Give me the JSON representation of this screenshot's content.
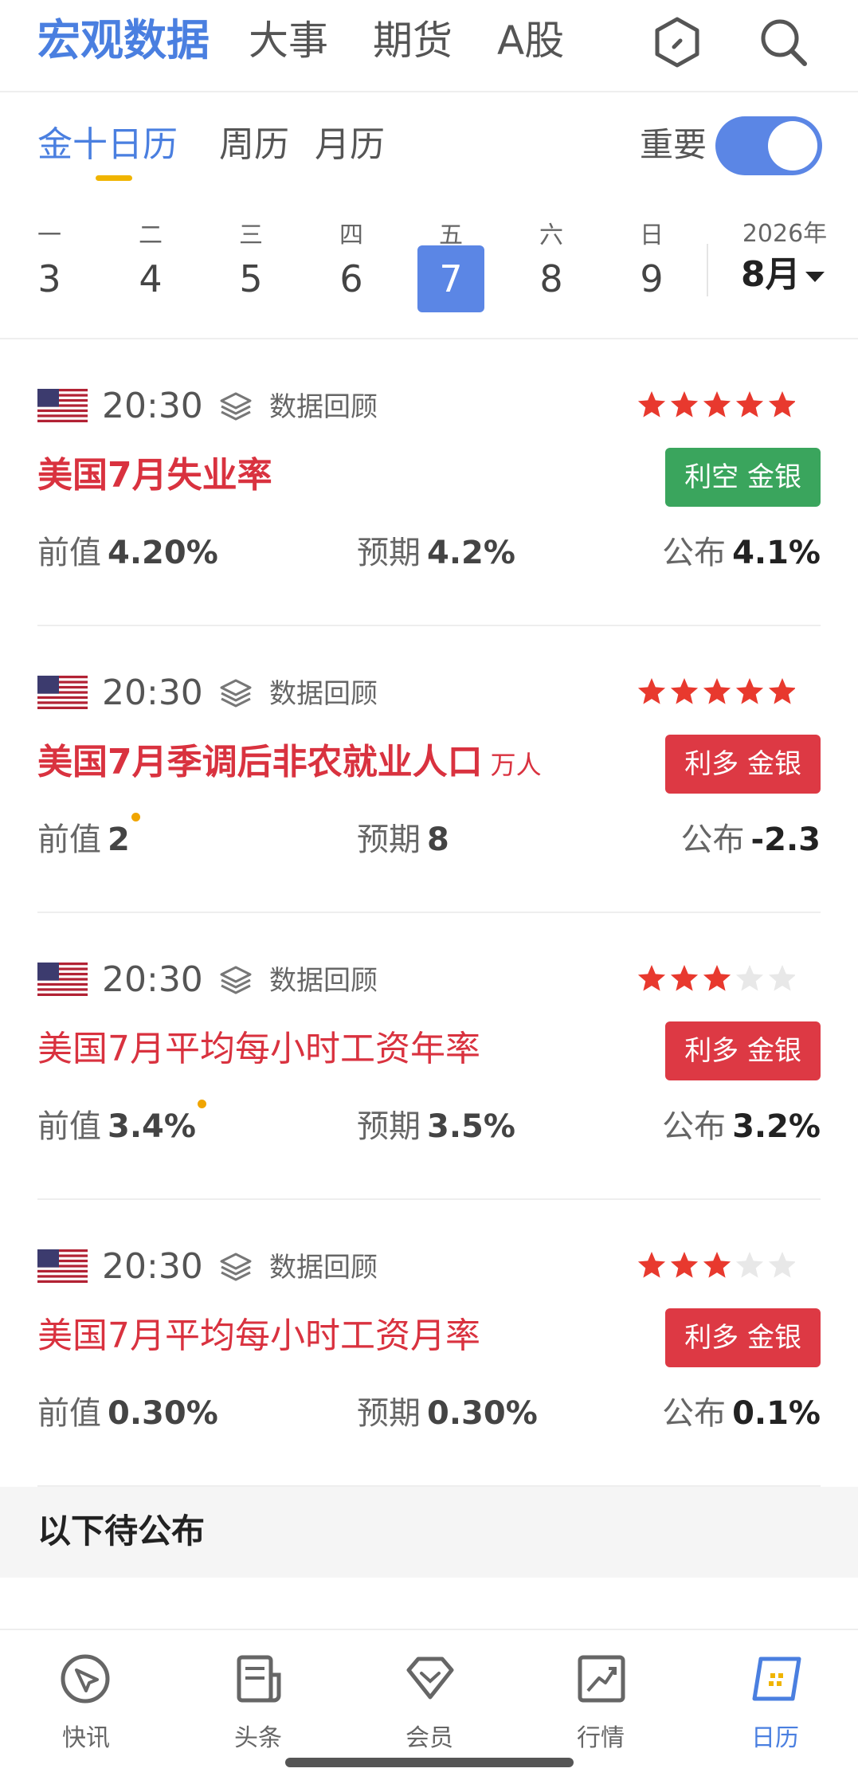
{
  "top_tabs": [
    "宏观数据",
    "大事",
    "期货",
    "A股"
  ],
  "sub_tabs": [
    "金十日历",
    "周历",
    "月历"
  ],
  "important_toggle": {
    "label": "重要",
    "on": true
  },
  "week": [
    {
      "name": "一",
      "num": "3"
    },
    {
      "name": "二",
      "num": "4"
    },
    {
      "name": "三",
      "num": "5"
    },
    {
      "name": "四",
      "num": "6"
    },
    {
      "name": "五",
      "num": "7"
    },
    {
      "name": "六",
      "num": "8"
    },
    {
      "name": "日",
      "num": "9"
    }
  ],
  "selected_day_index": 4,
  "year": "2026年",
  "month": "8月",
  "events": [
    {
      "time": "20:30",
      "type": "数据回顾",
      "stars": 5,
      "title": "美国7月失业率",
      "unit": "",
      "bold": true,
      "badge": "利空 金银",
      "badge_color": "#3aa55d",
      "prev_label": "前值",
      "prev": "4.20%",
      "exp_label": "预期",
      "exp": "4.2%",
      "pub_label": "公布",
      "pub": "4.1%",
      "revised": false
    },
    {
      "time": "20:30",
      "type": "数据回顾",
      "stars": 5,
      "title": "美国7月季调后非农就业人口",
      "unit": "万人",
      "bold": true,
      "badge": "利多 金银",
      "badge_color": "#dd3944",
      "prev_label": "前值",
      "prev": "2",
      "exp_label": "预期",
      "exp": "8",
      "pub_label": "公布",
      "pub": "-2.3",
      "revised": true
    },
    {
      "time": "20:30",
      "type": "数据回顾",
      "stars": 3,
      "title": "美国7月平均每小时工资年率",
      "unit": "",
      "bold": false,
      "badge": "利多 金银",
      "badge_color": "#dd3944",
      "prev_label": "前值",
      "prev": "3.4%",
      "exp_label": "预期",
      "exp": "3.5%",
      "pub_label": "公布",
      "pub": "3.2%",
      "revised": true
    },
    {
      "time": "20:30",
      "type": "数据回顾",
      "stars": 3,
      "title": "美国7月平均每小时工资月率",
      "unit": "",
      "bold": false,
      "badge": "利多 金银",
      "badge_color": "#dd3944",
      "prev_label": "前值",
      "prev": "0.30%",
      "exp_label": "预期",
      "exp": "0.30%",
      "pub_label": "公布",
      "pub": "0.1%",
      "revised": false
    }
  ],
  "pending_label": "以下待公布",
  "bottom_tabs": [
    "快讯",
    "头条",
    "会员",
    "行情",
    "日历"
  ],
  "bottom_active_index": 4,
  "colors": {
    "accent": "#5b86e5",
    "bullish": "#dd3944",
    "bearish": "#3aa55d",
    "star": "#e8392e"
  }
}
